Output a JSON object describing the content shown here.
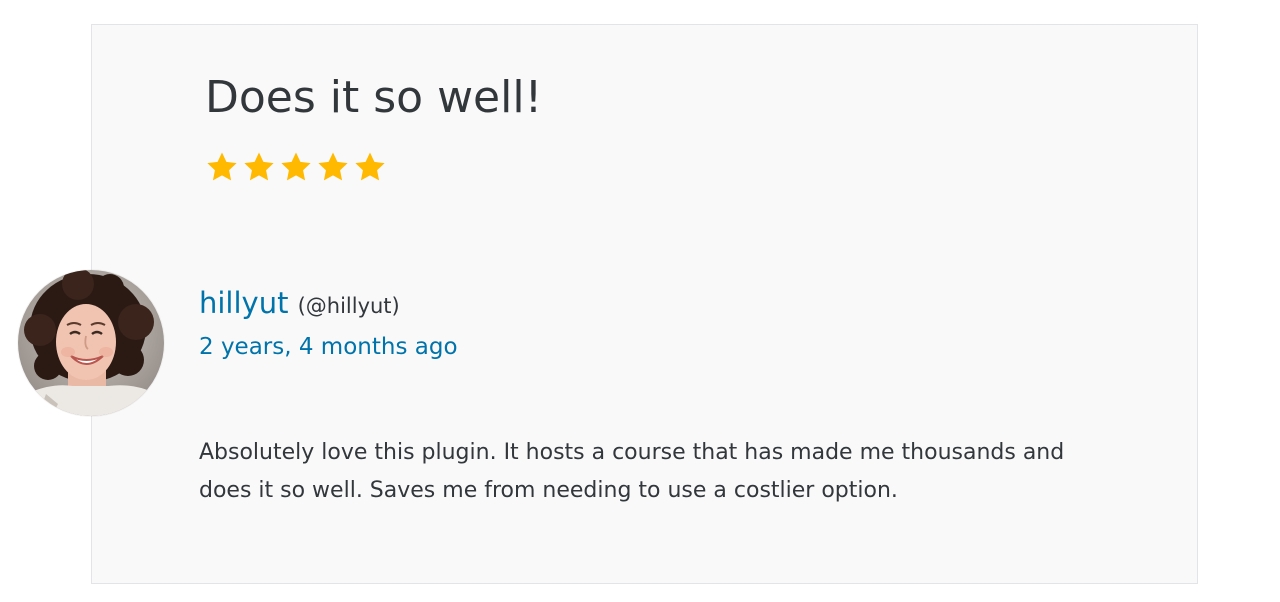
{
  "review": {
    "title": "Does it so well!",
    "rating": {
      "value": 5,
      "max": 5,
      "star_icon": "star-filled-icon",
      "star_color": "#ffb900"
    },
    "author": {
      "display_name": "hillyut",
      "handle": "(@hillyut)",
      "avatar_icon": "user-avatar-photo"
    },
    "timestamp": "2 years, 4 months ago",
    "body_lines": [
      "Absolutely love this plugin. It hosts a course that has made me thousands and",
      "does it so well. Saves me from needing to use a costlier option."
    ]
  },
  "colors": {
    "link": "#0073aa",
    "text": "#32373c",
    "card_bg": "#f9f9f9",
    "card_border": "#e2e4e7"
  }
}
